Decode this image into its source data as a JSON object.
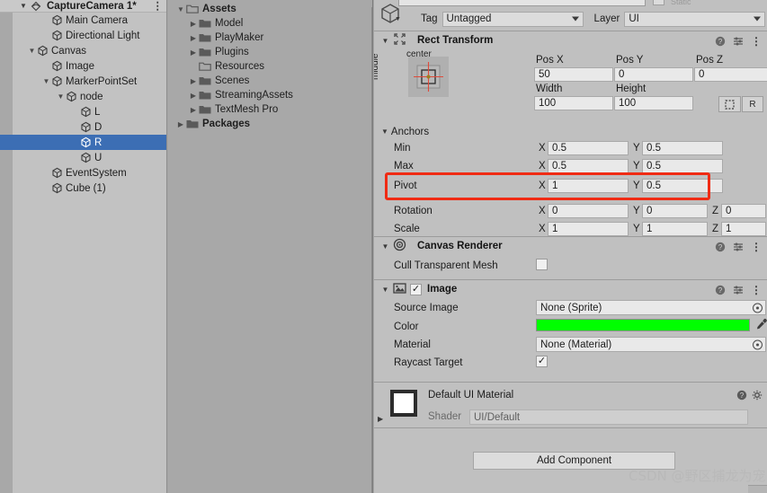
{
  "hierarchy": {
    "scene_name": "CaptureCamera 1*",
    "scene_icon": "unity-scene-icon",
    "menu_icon": "kebab-menu-icon",
    "items": [
      {
        "label": "Main Camera",
        "indent": 2,
        "arrow": "",
        "icon": "gameobject-cube-icon",
        "selected": false
      },
      {
        "label": "Directional Light",
        "indent": 2,
        "arrow": "",
        "icon": "gameobject-cube-icon",
        "selected": false
      },
      {
        "label": "Canvas",
        "indent": 1,
        "arrow": "▼",
        "icon": "gameobject-cube-icon",
        "selected": false
      },
      {
        "label": "Image",
        "indent": 2,
        "arrow": "",
        "icon": "gameobject-cube-icon",
        "selected": false
      },
      {
        "label": "MarkerPointSet",
        "indent": 2,
        "arrow": "▼",
        "icon": "gameobject-cube-icon",
        "selected": false
      },
      {
        "label": "node",
        "indent": 3,
        "arrow": "▼",
        "icon": "gameobject-cube-icon",
        "selected": false
      },
      {
        "label": "L",
        "indent": 4,
        "arrow": "",
        "icon": "gameobject-cube-icon",
        "selected": false
      },
      {
        "label": "D",
        "indent": 4,
        "arrow": "",
        "icon": "gameobject-cube-icon",
        "selected": false
      },
      {
        "label": "R",
        "indent": 4,
        "arrow": "",
        "icon": "gameobject-cube-icon",
        "selected": true
      },
      {
        "label": "U",
        "indent": 4,
        "arrow": "",
        "icon": "gameobject-cube-icon",
        "selected": false
      },
      {
        "label": "EventSystem",
        "indent": 2,
        "arrow": "",
        "icon": "gameobject-cube-icon",
        "selected": false
      },
      {
        "label": "Cube (1)",
        "indent": 2,
        "arrow": "",
        "icon": "gameobject-cube-icon",
        "selected": false
      }
    ]
  },
  "project": {
    "items": [
      {
        "label": "Assets",
        "indent": 0,
        "arrow": "▼",
        "icon": "folder-open-icon",
        "bold": true
      },
      {
        "label": "Model",
        "indent": 1,
        "arrow": "▶",
        "icon": "folder-icon",
        "bold": false
      },
      {
        "label": "PlayMaker",
        "indent": 1,
        "arrow": "▶",
        "icon": "folder-icon",
        "bold": false
      },
      {
        "label": "Plugins",
        "indent": 1,
        "arrow": "▶",
        "icon": "folder-icon",
        "bold": false
      },
      {
        "label": "Resources",
        "indent": 1,
        "arrow": "",
        "icon": "folder-open-icon",
        "bold": false
      },
      {
        "label": "Scenes",
        "indent": 1,
        "arrow": "▶",
        "icon": "folder-icon",
        "bold": false
      },
      {
        "label": "StreamingAssets",
        "indent": 1,
        "arrow": "▶",
        "icon": "folder-icon",
        "bold": false
      },
      {
        "label": "TextMesh Pro",
        "indent": 1,
        "arrow": "▶",
        "icon": "folder-icon",
        "bold": false
      },
      {
        "label": "Packages",
        "indent": 0,
        "arrow": "▶",
        "icon": "folder-icon",
        "bold": true
      }
    ]
  },
  "inspector": {
    "tag_label": "Tag",
    "tag_value": "Untagged",
    "layer_label": "Layer",
    "layer_value": "UI",
    "rect_transform": {
      "title": "Rect Transform",
      "anchor_preset_h": "center",
      "anchor_preset_v": "middle",
      "pos_x_label": "Pos X",
      "pos_x": "50",
      "pos_y_label": "Pos Y",
      "pos_y": "0",
      "pos_z_label": "Pos Z",
      "pos_z": "0",
      "width_label": "Width",
      "width": "100",
      "height_label": "Height",
      "height": "100",
      "blueprint_button": "blueprint-mode-icon",
      "raw_button": "R",
      "anchors_label": "Anchors",
      "min_label": "Min",
      "min_x": "0.5",
      "min_y": "0.5",
      "max_label": "Max",
      "max_x": "0.5",
      "max_y": "0.5",
      "pivot_label": "Pivot",
      "pivot_x": "1",
      "pivot_y": "0.5",
      "rotation_label": "Rotation",
      "rot_x": "0",
      "rot_y": "0",
      "rot_z": "0",
      "scale_label": "Scale",
      "scale_x": "1",
      "scale_y": "1",
      "scale_z": "1",
      "axis_x": "X",
      "axis_y": "Y",
      "axis_z": "Z"
    },
    "canvas_renderer": {
      "title": "Canvas Renderer",
      "cull_label": "Cull Transparent Mesh",
      "cull_checked": false
    },
    "image": {
      "title": "Image",
      "enabled": true,
      "source_image_label": "Source Image",
      "source_image_value": "None (Sprite)",
      "color_label": "Color",
      "color_value": "#00FF00",
      "material_label": "Material",
      "material_value": "None (Material)",
      "raycast_label": "Raycast Target",
      "raycast_checked": true
    },
    "material_preview": {
      "name": "Default UI Material",
      "shader_label": "Shader",
      "shader_value": "UI/Default"
    },
    "add_component_label": "Add Component",
    "highlight_color": "#F02B14"
  },
  "watermark": {
    "text": "CSDN @野区捕龙为宠"
  }
}
